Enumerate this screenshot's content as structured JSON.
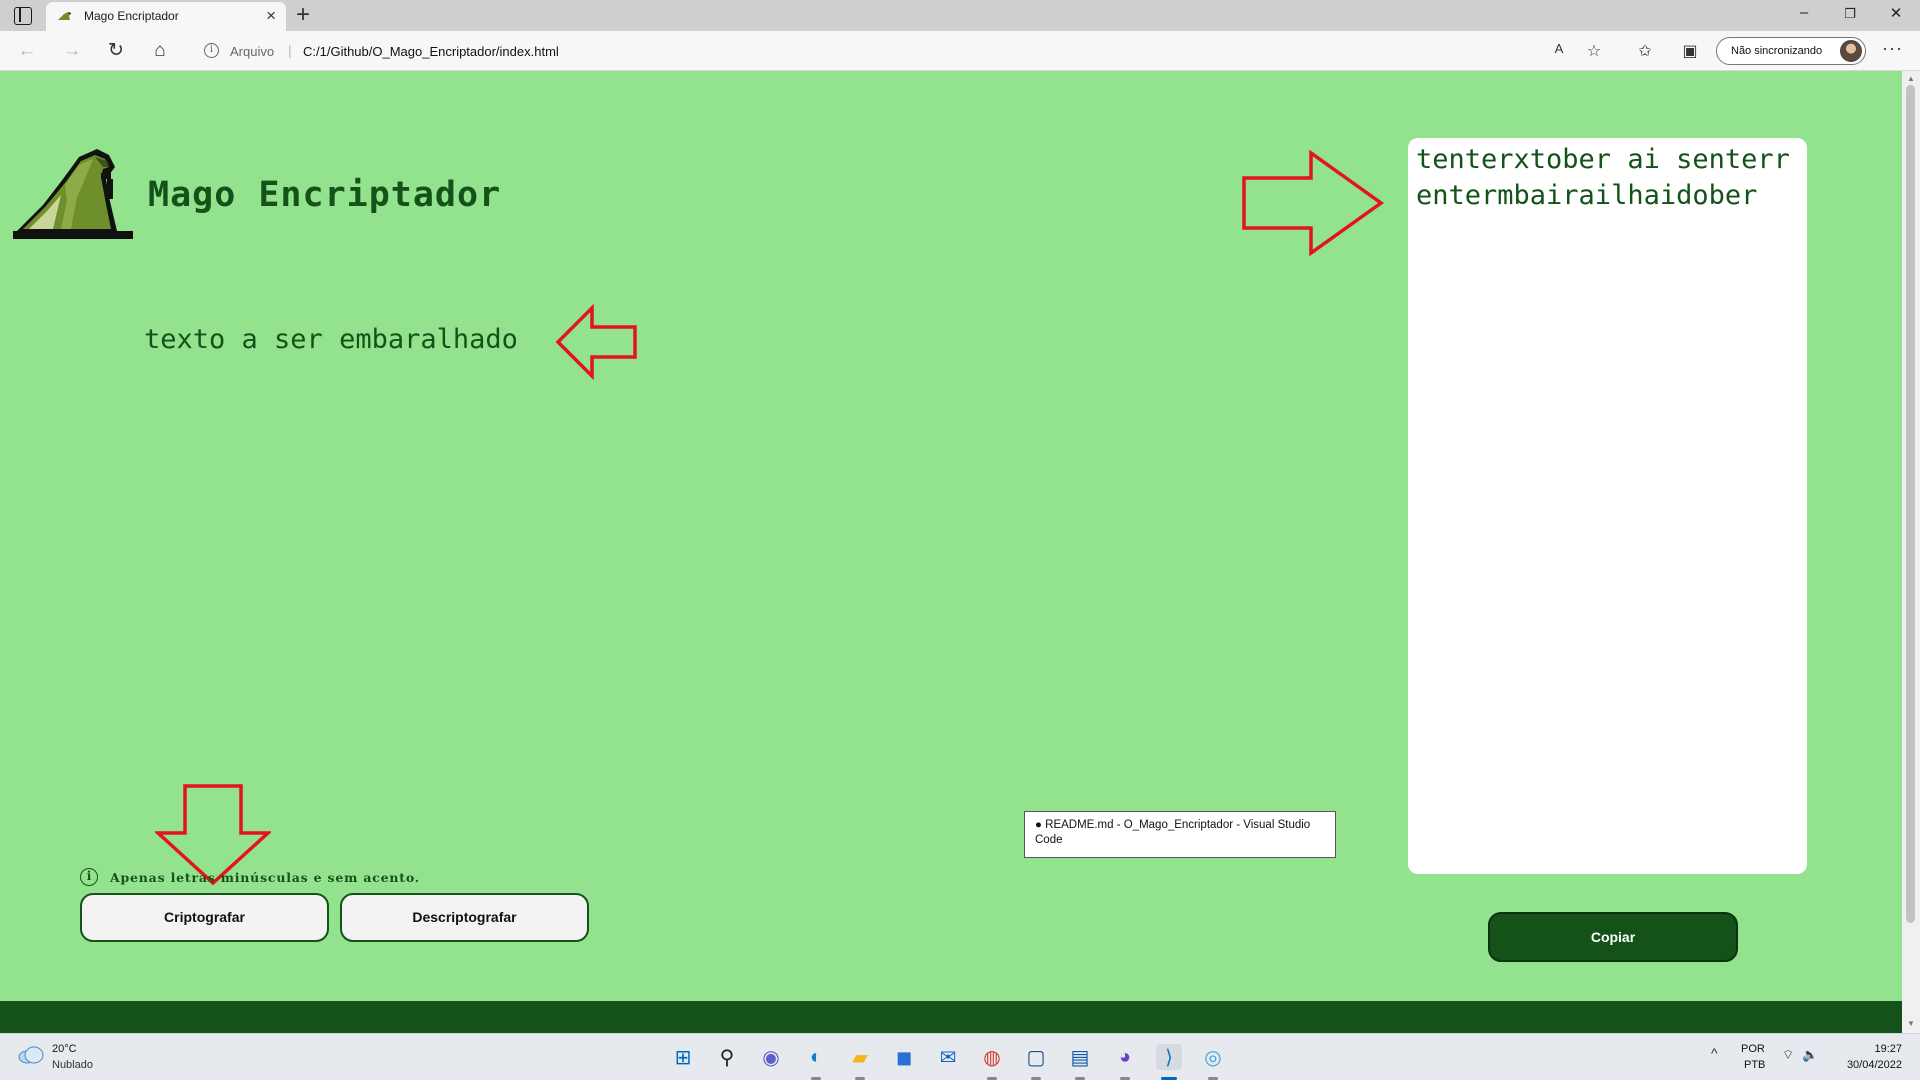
{
  "browser": {
    "tab_title": "Mago Encriptador",
    "tab_close": "×",
    "new_tab": "+",
    "window_controls": {
      "minimize": "–",
      "restore": "❐",
      "close": "✕"
    },
    "nav": {
      "back": "←",
      "forward": "→",
      "reload": "↻",
      "home": "⌂"
    },
    "address": {
      "scheme_label": "Arquivo",
      "separator": "|",
      "url": "C:/1/Github/O_Mago_Encriptador/index.html",
      "info_icon": "i"
    },
    "toolbar_icons": {
      "read_aloud": "A",
      "add_favorite": "☆",
      "favorites": "✩",
      "collections": "▣"
    },
    "sync_label": "Não sincronizando",
    "menu": "···"
  },
  "app": {
    "title": "Mago Encriptador",
    "input_text": "texto a ser embaralhado",
    "output_text": "tenterxtober ai senterrentermbairailhaidober",
    "hint": "Apenas letras minúsculas e sem acento.",
    "hint_icon": "i",
    "buttons": {
      "encrypt": "Criptografar",
      "decrypt": "Descriptografar",
      "copy": "Copiar"
    },
    "colors": {
      "background": "#93e38e",
      "primary": "#14521a",
      "arrow": "#e3141a",
      "panel": "#ffffff"
    }
  },
  "tooltip": "● README.md - O_Mago_Encriptador - Visual Studio Code",
  "scrollbar": {
    "up": "▲",
    "down": "▼"
  },
  "taskbar": {
    "weather": {
      "temp": "20°C",
      "condition": "Nublado"
    },
    "icons": [
      {
        "name": "windows-start-icon",
        "glyph": "⊞",
        "color": "#0067c0"
      },
      {
        "name": "search-icon",
        "glyph": "⚲",
        "color": "#222222"
      },
      {
        "name": "teams-chat-icon",
        "glyph": "◉",
        "color": "#5b5fc7"
      },
      {
        "name": "edge-browser-icon",
        "glyph": "◐",
        "color": "#0f7bd0"
      },
      {
        "name": "file-explorer-icon",
        "glyph": "▰",
        "color": "#f2b51c"
      },
      {
        "name": "microsoft-store-icon",
        "glyph": "◼",
        "color": "#2a6fd6"
      },
      {
        "name": "mail-icon",
        "glyph": "✉",
        "color": "#1565c0"
      },
      {
        "name": "chrome-icon",
        "glyph": "◍",
        "color": "#d83b2f"
      },
      {
        "name": "bracket-app-icon",
        "glyph": "▢",
        "color": "#1a4f8a"
      },
      {
        "name": "photos-app-icon",
        "glyph": "▤",
        "color": "#0b5aa8"
      },
      {
        "name": "github-desktop-icon",
        "glyph": "◕",
        "color": "#6e40c9"
      },
      {
        "name": "vscode-icon",
        "glyph": "⟩",
        "color": "#0078d4"
      },
      {
        "name": "network-globe-icon",
        "glyph": "◎",
        "color": "#3ea6d8"
      }
    ],
    "tray": {
      "chevron": "^",
      "lang": "POR",
      "layout": "PTB",
      "wifi": "⌔",
      "volume": "🔈",
      "time": "19:27",
      "date": "30/04/2022"
    }
  }
}
